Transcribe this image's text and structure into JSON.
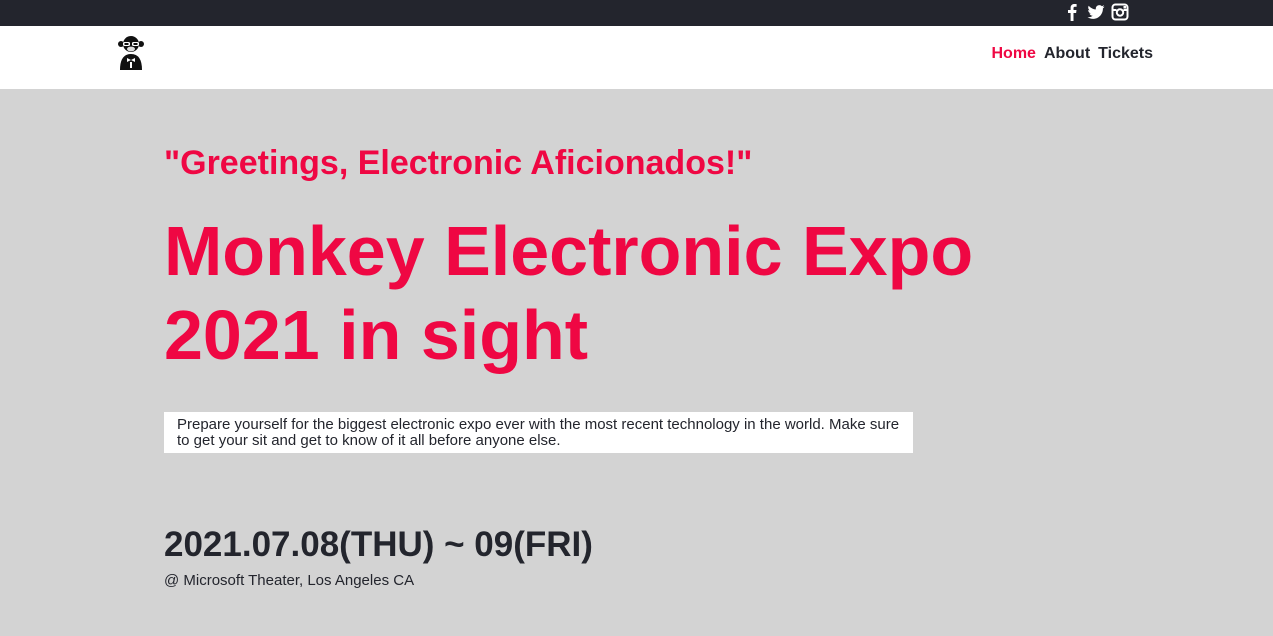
{
  "social": {
    "items": [
      {
        "name": "facebook",
        "icon": "facebook-icon"
      },
      {
        "name": "twitter",
        "icon": "twitter-icon"
      },
      {
        "name": "instagram",
        "icon": "instagram-icon"
      }
    ]
  },
  "header": {
    "logo_icon": "monkey-logo-icon",
    "nav": [
      {
        "label": "Home",
        "active": true
      },
      {
        "label": "About",
        "active": false
      },
      {
        "label": "Tickets",
        "active": false
      }
    ]
  },
  "hero": {
    "greeting": "\"Greetings, Electronic Aficionados!\"",
    "headline": "Monkey Electronic Expo 2021 in sight",
    "description": "Prepare yourself for the biggest electronic expo ever with the most recent technology in the world. Make sure to get your sit and get to know of it all before anyone else.",
    "date": "2021.07.08(THU) ~ 09(FRI)",
    "venue": "@ Microsoft Theater, Los Angeles CA"
  },
  "colors": {
    "accent": "#ef0743",
    "topbar": "#23252d",
    "background": "#d3d3d3",
    "text": "#23252d"
  }
}
